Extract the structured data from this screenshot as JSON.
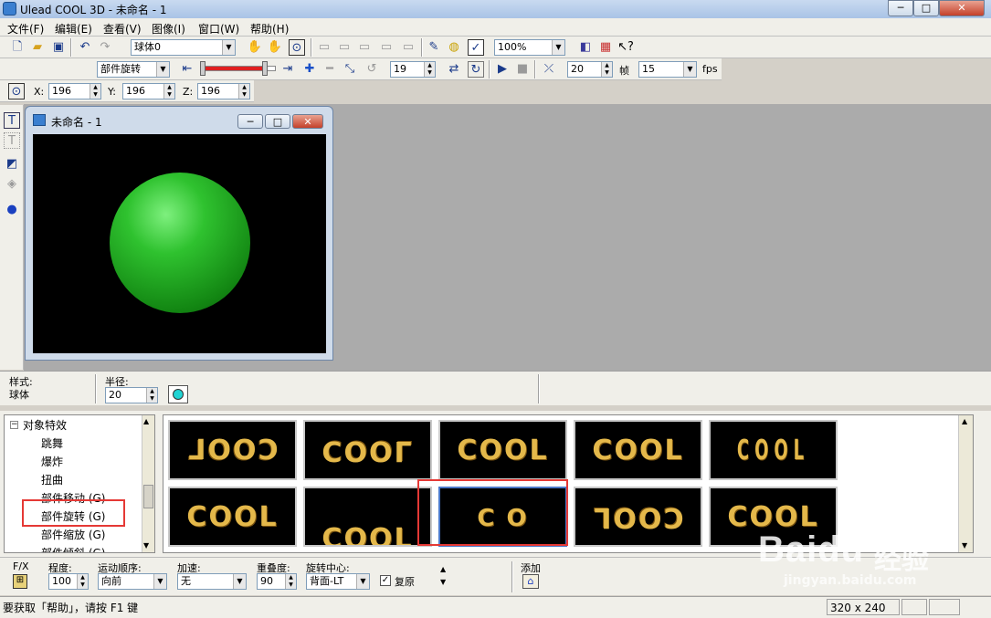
{
  "window": {
    "title": "Ulead COOL 3D - 未命名 - 1",
    "min": "─",
    "max": "□",
    "close": "✕"
  },
  "menu": [
    "文件(F)",
    "编辑(E)",
    "查看(V)",
    "图像(I)",
    "窗口(W)",
    "帮助(H)"
  ],
  "toolbar1": {
    "object_combo": "球体0",
    "zoom_combo": "100%"
  },
  "toolbar2": {
    "effect_combo": "部件旋转",
    "frame_value": "19",
    "frames_total": "20",
    "frames_label": "帧",
    "fps_value": "15",
    "fps_label": "fps"
  },
  "toolbar3": {
    "x_label": "X:",
    "x_value": "196",
    "y_label": "Y:",
    "y_value": "196",
    "z_label": "Z:",
    "z_value": "196"
  },
  "child_window": {
    "title": "未命名 - 1",
    "sphere_color": "#22b022"
  },
  "properties": {
    "style_label": "样式:",
    "style_value": "球体",
    "radius_label": "半径:",
    "radius_value": "20",
    "swatch_color": "#21d4d4"
  },
  "tree": {
    "root": "对象特效",
    "items": [
      "跳舞",
      "爆炸",
      "扭曲",
      "部件移动 (G)",
      "部件旋转 (G)",
      "部件缩放 (G)",
      "部件倾斜 (G)"
    ]
  },
  "gallery": {
    "row1": [
      "COOL",
      "COOL",
      "COOL",
      "COOL",
      "COOL"
    ],
    "row2": [
      "COOL",
      "COOL",
      "C O",
      "COOL",
      "COOL"
    ]
  },
  "fx": {
    "fx_label": "F/X",
    "degree_label": "程度:",
    "degree_value": "100",
    "order_label": "运动顺序:",
    "order_value": "向前",
    "accel_label": "加速:",
    "accel_value": "无",
    "overlap_label": "重叠度:",
    "overlap_value": "90",
    "center_label": "旋转中心:",
    "center_value": "背面-LT",
    "restore_label": "复原",
    "add_label": "添加"
  },
  "status": {
    "help": "要获取「帮助」，请按 F1 键",
    "size": "320 x 240"
  },
  "watermark": {
    "brand": "Baidu",
    "brand_cn": "经验",
    "url": "jingyan.baidu.com"
  }
}
